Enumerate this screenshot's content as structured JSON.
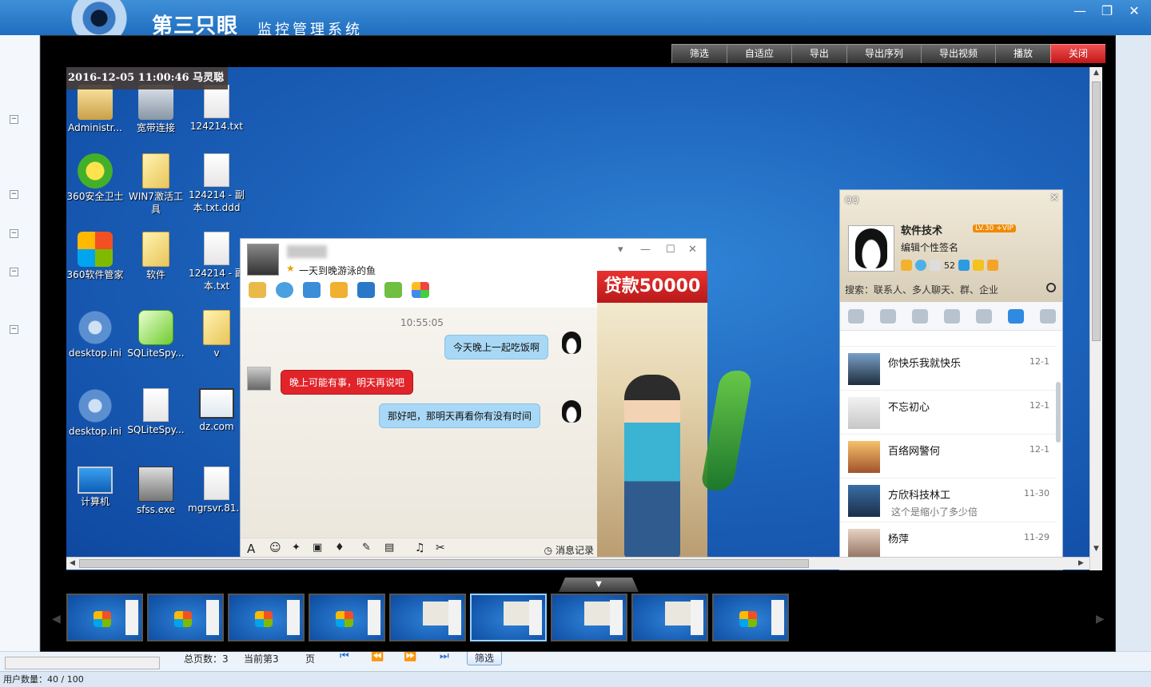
{
  "app": {
    "title": "第三只眼",
    "subtitle": "监控管理系统",
    "window_controls": [
      "—",
      "❐",
      "✕"
    ]
  },
  "toolbar": {
    "buttons": [
      "筛选",
      "自适应",
      "导出",
      "导出序列",
      "导出视频",
      "播放",
      "关闭"
    ]
  },
  "screenshot": {
    "stamp": "2016-12-05 11:00:46 马灵聪",
    "desktop_icons": [
      {
        "label": "Administr...",
        "icon": "user-folder-icon"
      },
      {
        "label": "宽带连接",
        "icon": "network-icon"
      },
      {
        "label": "124214.txt",
        "icon": "file-icon"
      },
      {
        "label": "360安全卫士",
        "icon": "360-icon"
      },
      {
        "label": "WIN7激活工具",
        "icon": "folder-icon"
      },
      {
        "label": "124214 - 副本.txt.ddd",
        "icon": "file-icon"
      },
      {
        "label": "360软件管家",
        "icon": "windows-store-icon"
      },
      {
        "label": "软件",
        "icon": "folder-icon"
      },
      {
        "label": "124214 - 副本.txt",
        "icon": "file-icon"
      },
      {
        "label": "desktop.ini",
        "icon": "gear-file-icon"
      },
      {
        "label": "SQLiteSpy...",
        "icon": "sqlite-icon"
      },
      {
        "label": "v",
        "icon": "folder-icon"
      },
      {
        "label": "desktop.ini",
        "icon": "gear-file-icon"
      },
      {
        "label": "SQLiteSpy...",
        "icon": "file-icon"
      },
      {
        "label": "dz.com",
        "icon": "web-icon"
      },
      {
        "label": "计算机",
        "icon": "computer-icon"
      },
      {
        "label": "sfss.exe",
        "icon": "exe-icon"
      },
      {
        "label": "mgrsvr.81...",
        "icon": "file-icon"
      }
    ],
    "chat": {
      "signature": "一天到晚游泳的鱼",
      "time": "10:55:05",
      "messages": [
        {
          "from": "me",
          "text": "今天晚上一起吃饭啊"
        },
        {
          "from": "other",
          "text": "晚上可能有事，明天再说吧"
        },
        {
          "from": "me",
          "text": "那好吧，那明天再看你有没有时间"
        }
      ],
      "history_label": "消息记录",
      "ad_text": "贷款50000"
    },
    "qq": {
      "nickname": "软件技术",
      "vip": "LV.30 +VIP",
      "signature": "编辑个性签名",
      "mail_count": "52",
      "search_placeholder": "搜索：联系人、多人聊天、群、企业",
      "contacts": [
        {
          "name": "你快乐我就快乐",
          "date": "12-1",
          "msg": ""
        },
        {
          "name": "不忘初心",
          "date": "12-1",
          "msg": ""
        },
        {
          "name": "百络网警何",
          "date": "12-1",
          "msg": ""
        },
        {
          "name": "方欣科技林工",
          "date": "11-30",
          "msg": "这个是缩小了多少倍"
        },
        {
          "name": "杨萍",
          "date": "11-29",
          "msg": ""
        }
      ]
    }
  },
  "pager": {
    "total_pages": "总页数：3",
    "current_page": "当前第3",
    "page_suffix": "页",
    "filter": "筛选"
  },
  "status": {
    "user_count": "用户数量：40 / 100"
  },
  "colors": {
    "header_blue": "#1f6ec0",
    "close_red": "#d42020",
    "bubble_blue": "#a8d8f5",
    "bubble_red": "#e0242a"
  }
}
